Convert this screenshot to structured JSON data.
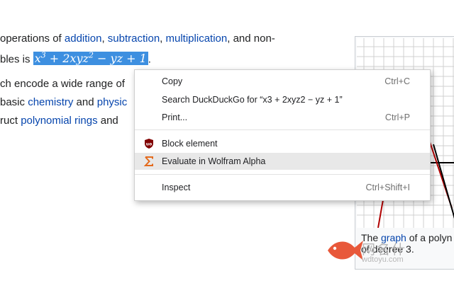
{
  "article": {
    "line1": {
      "pre": "operations of ",
      "l1": "addition",
      "c1": ", ",
      "l2": "subtraction",
      "c2": ", ",
      "l3": "multiplication",
      "post": ", and non-"
    },
    "line2": {
      "pre": "bles is "
    },
    "math": {
      "x": "x",
      "exp3": "3",
      "mid": " + 2xyz",
      "exp2": "2",
      "tail": " − yz + 1"
    },
    "line2_post": ".",
    "line3": {
      "pre": "ch encode a wide range of"
    },
    "line4": {
      "pre": "basic ",
      "l1": "chemistry",
      "c1": " and ",
      "l2": "physic"
    },
    "line5": {
      "pre": "ruct ",
      "l1": "polynomial rings",
      "post": " and"
    }
  },
  "figure": {
    "caption_pre": "The ",
    "caption_link": "graph",
    "caption_post": " of a polyn",
    "caption_line2": "of degree 3."
  },
  "context_menu": {
    "items": [
      {
        "label": "Copy",
        "shortcut": "Ctrl+C"
      },
      {
        "label": "Search DuckDuckGo for “x3 + 2xyz2 − yz + 1”",
        "shortcut": ""
      },
      {
        "label": "Print...",
        "shortcut": "Ctrl+P"
      },
      {
        "label": "Block element",
        "shortcut": "",
        "icon": "ublock-icon"
      },
      {
        "label": "Evaluate in Wolfram Alpha",
        "shortcut": "",
        "icon": "wolfram-alpha-icon"
      },
      {
        "label": "Inspect",
        "shortcut": "Ctrl+Shift+I"
      }
    ]
  },
  "watermark": {
    "text": "网名什",
    "url": "wdtoyu.com"
  },
  "colors": {
    "link": "#0645ad",
    "selection": "#3d8fe0",
    "wolfram": "#e36a1d",
    "ublock": "#800000",
    "curve": "#b00000"
  }
}
